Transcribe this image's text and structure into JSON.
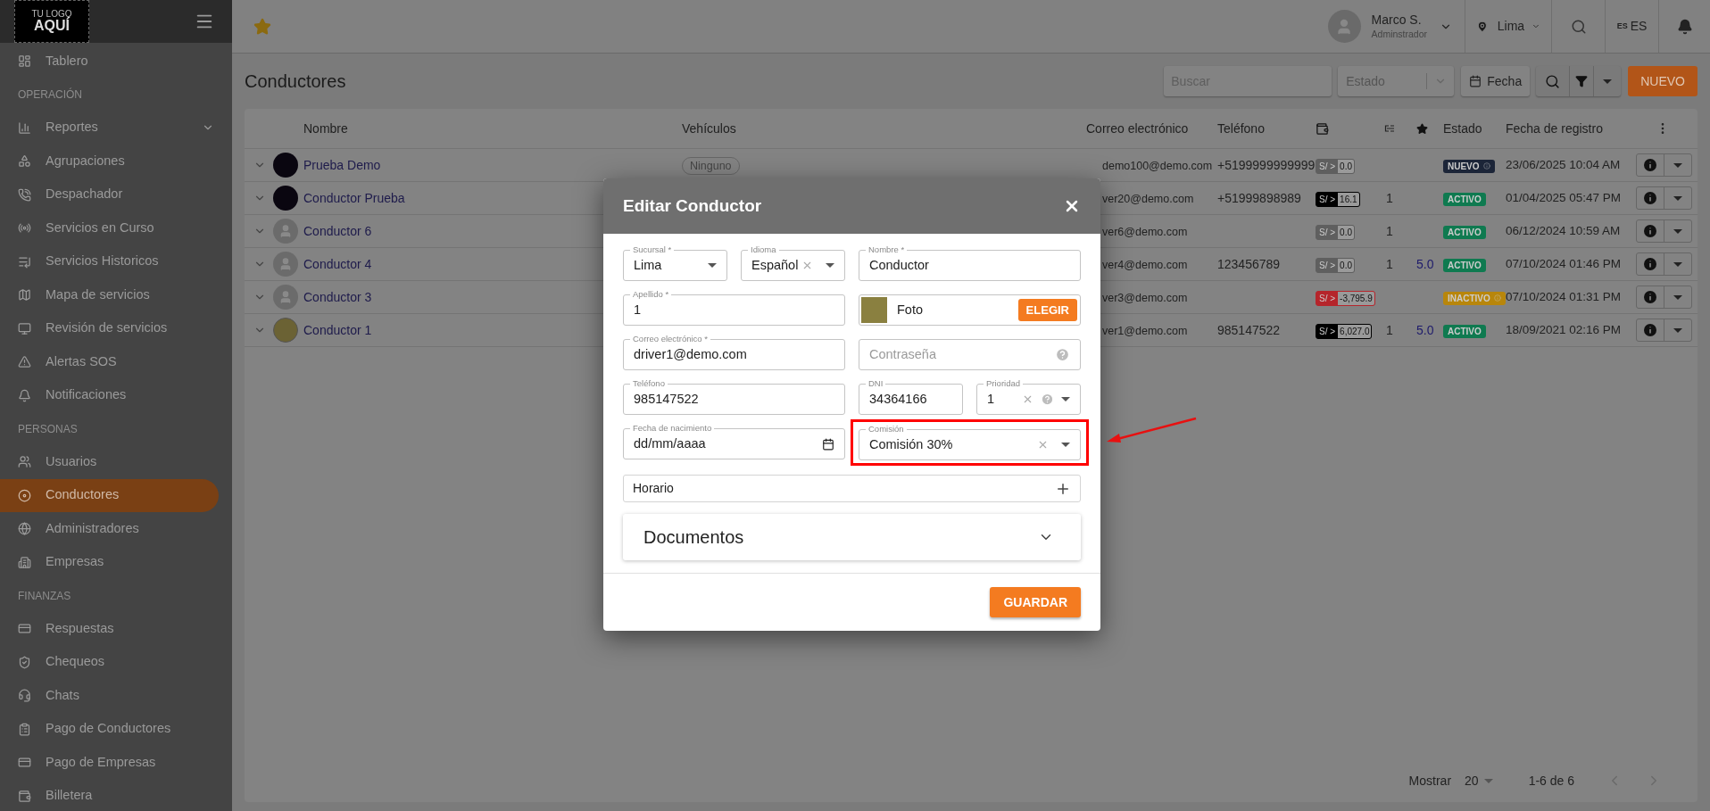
{
  "sidebar": {
    "logo": {
      "line_1": "TU LOGO",
      "line_2": "AQUÍ"
    },
    "items": [
      {
        "kind": "item",
        "label": "Tablero",
        "selected": false
      },
      {
        "kind": "section",
        "label": "OPERACIÓN"
      },
      {
        "kind": "item",
        "label": "Reportes",
        "selected": false,
        "expandable": true
      },
      {
        "kind": "item",
        "label": "Agrupaciones",
        "selected": false
      },
      {
        "kind": "item",
        "label": "Despachador",
        "selected": false
      },
      {
        "kind": "item",
        "label": "Servicios en Curso",
        "selected": false
      },
      {
        "kind": "item",
        "label": "Servicios Historicos",
        "selected": false
      },
      {
        "kind": "item",
        "label": "Mapa de servicios",
        "selected": false
      },
      {
        "kind": "item",
        "label": "Revisión de servicios",
        "selected": false
      },
      {
        "kind": "item",
        "label": "Alertas SOS",
        "selected": false
      },
      {
        "kind": "item",
        "label": "Notificaciones",
        "selected": false
      },
      {
        "kind": "section",
        "label": "PERSONAS"
      },
      {
        "kind": "item",
        "label": "Usuarios",
        "selected": false
      },
      {
        "kind": "item",
        "label": "Conductores",
        "selected": true
      },
      {
        "kind": "item",
        "label": "Administradores",
        "selected": false
      },
      {
        "kind": "item",
        "label": "Empresas",
        "selected": false
      },
      {
        "kind": "section",
        "label": "FINANZAS"
      },
      {
        "kind": "item",
        "label": "Respuestas",
        "selected": false
      },
      {
        "kind": "item",
        "label": "Chequeos",
        "selected": false
      },
      {
        "kind": "item",
        "label": "Chats",
        "selected": false
      },
      {
        "kind": "item",
        "label": "Pago de Conductores",
        "selected": false
      },
      {
        "kind": "item",
        "label": "Pago de Empresas",
        "selected": false
      },
      {
        "kind": "item",
        "label": "Billetera",
        "selected": false
      }
    ]
  },
  "header": {
    "user": {
      "name": "Marco S.",
      "role": "Adminstrador"
    },
    "city": "Lima",
    "language": {
      "code": "ES",
      "label": "ES"
    }
  },
  "page": {
    "title": "Conductores",
    "search": {
      "placeholder": "Buscar"
    },
    "status_filter": {
      "placeholder": "Estado"
    },
    "date_button": "Fecha",
    "new_button": "NUEVO"
  },
  "table": {
    "columns": [
      "Nombre",
      "Vehículos",
      "Correo electrónico",
      "Teléfono",
      "Estado",
      "Fecha de registro"
    ],
    "rows": [
      {
        "avatar": {
          "kind": "dark"
        },
        "name": "Prueba Demo",
        "vehicles": "Ninguno",
        "email": "demo100@demo.com",
        "phone": "+5199999999999",
        "wallet": {
          "prefix": "S/ >",
          "amount": "0.0",
          "color": "#5f5f5f"
        },
        "count": "",
        "rating": "",
        "status": {
          "label": "NUEVO",
          "color": "#1c2538",
          "info": true
        },
        "date": "23/06/2025 10:04 AM"
      },
      {
        "avatar": {
          "kind": "dark"
        },
        "name": "Conductor Prueba",
        "email": "ver20@demo.com",
        "phone": "+51999898989",
        "wallet": {
          "prefix": "S/ >",
          "amount": "16.1",
          "color": "#000000"
        },
        "count": "1",
        "rating": "",
        "status": {
          "label": "ACTIVO",
          "color": "#0f7a50",
          "info": false
        },
        "date": "01/04/2025 05:47 PM"
      },
      {
        "avatar": {
          "kind": "default"
        },
        "name": "Conductor 6",
        "email": "ver6@demo.com",
        "phone": "",
        "wallet": {
          "prefix": "S/ >",
          "amount": "0.0",
          "color": "#5f5f5f"
        },
        "count": "1",
        "rating": "",
        "status": {
          "label": "ACTIVO",
          "color": "#0f7a50",
          "info": false
        },
        "date": "06/12/2024 10:59 AM"
      },
      {
        "avatar": {
          "kind": "default"
        },
        "name": "Conductor 4",
        "email": "ver4@demo.com",
        "phone": "123456789",
        "wallet": {
          "prefix": "S/ >",
          "amount": "0.0",
          "color": "#5f5f5f"
        },
        "count": "1",
        "rating": "5.0",
        "status": {
          "label": "ACTIVO",
          "color": "#0f7a50",
          "info": false
        },
        "date": "07/10/2024 01:46 PM"
      },
      {
        "avatar": {
          "kind": "default"
        },
        "name": "Conductor 3",
        "email": "ver3@demo.com",
        "phone": "",
        "wallet": {
          "prefix": "S/ >",
          "amount": "-3,795.9",
          "color": "#b5252b"
        },
        "count": "",
        "rating": "",
        "status": {
          "label": "INACTIVO",
          "color": "#b8860b",
          "info": true
        },
        "date": "07/10/2024 01:31 PM"
      },
      {
        "avatar": {
          "kind": "photo"
        },
        "name": "Conductor 1",
        "email": "ver1@demo.com",
        "phone": "985147522",
        "wallet": {
          "prefix": "S/ >",
          "amount": "6,027.0",
          "color": "#000000"
        },
        "count": "1",
        "rating": "5.0",
        "status": {
          "label": "ACTIVO",
          "color": "#0f7a50",
          "info": false
        },
        "date": "18/09/2021 02:16 PM"
      }
    ]
  },
  "pagination": {
    "label": "Mostrar",
    "page_size": "20",
    "range": "1-6 de 6"
  },
  "modal": {
    "title": "Editar Conductor",
    "sucursal": {
      "label": "Sucursal *",
      "value": "Lima"
    },
    "idioma": {
      "label": "Idioma",
      "value": "Español"
    },
    "nombre": {
      "label": "Nombre *",
      "value": "Conductor"
    },
    "apellido": {
      "label": "Apellido *",
      "value": "1"
    },
    "foto": {
      "label": "Foto",
      "button": "ELEGIR"
    },
    "correo": {
      "label": "Correo electrónico *",
      "value": "driver1@demo.com"
    },
    "password": {
      "placeholder": "Contraseña"
    },
    "telefono": {
      "label": "Teléfono",
      "value": "985147522"
    },
    "dni": {
      "label": "DNI",
      "value": "34364166"
    },
    "prioridad": {
      "label": "Prioridad",
      "value": "1"
    },
    "nacimiento": {
      "label": "Fecha de nacimiento",
      "placeholder": "dd/mm/aaaa"
    },
    "comision": {
      "label": "Comisión",
      "value": "Comisión 30%",
      "highlighted": true
    },
    "horario": {
      "label": "Horario"
    },
    "documentos": {
      "label": "Documentos",
      "expanded": false
    },
    "save_button": "GUARDAR"
  }
}
